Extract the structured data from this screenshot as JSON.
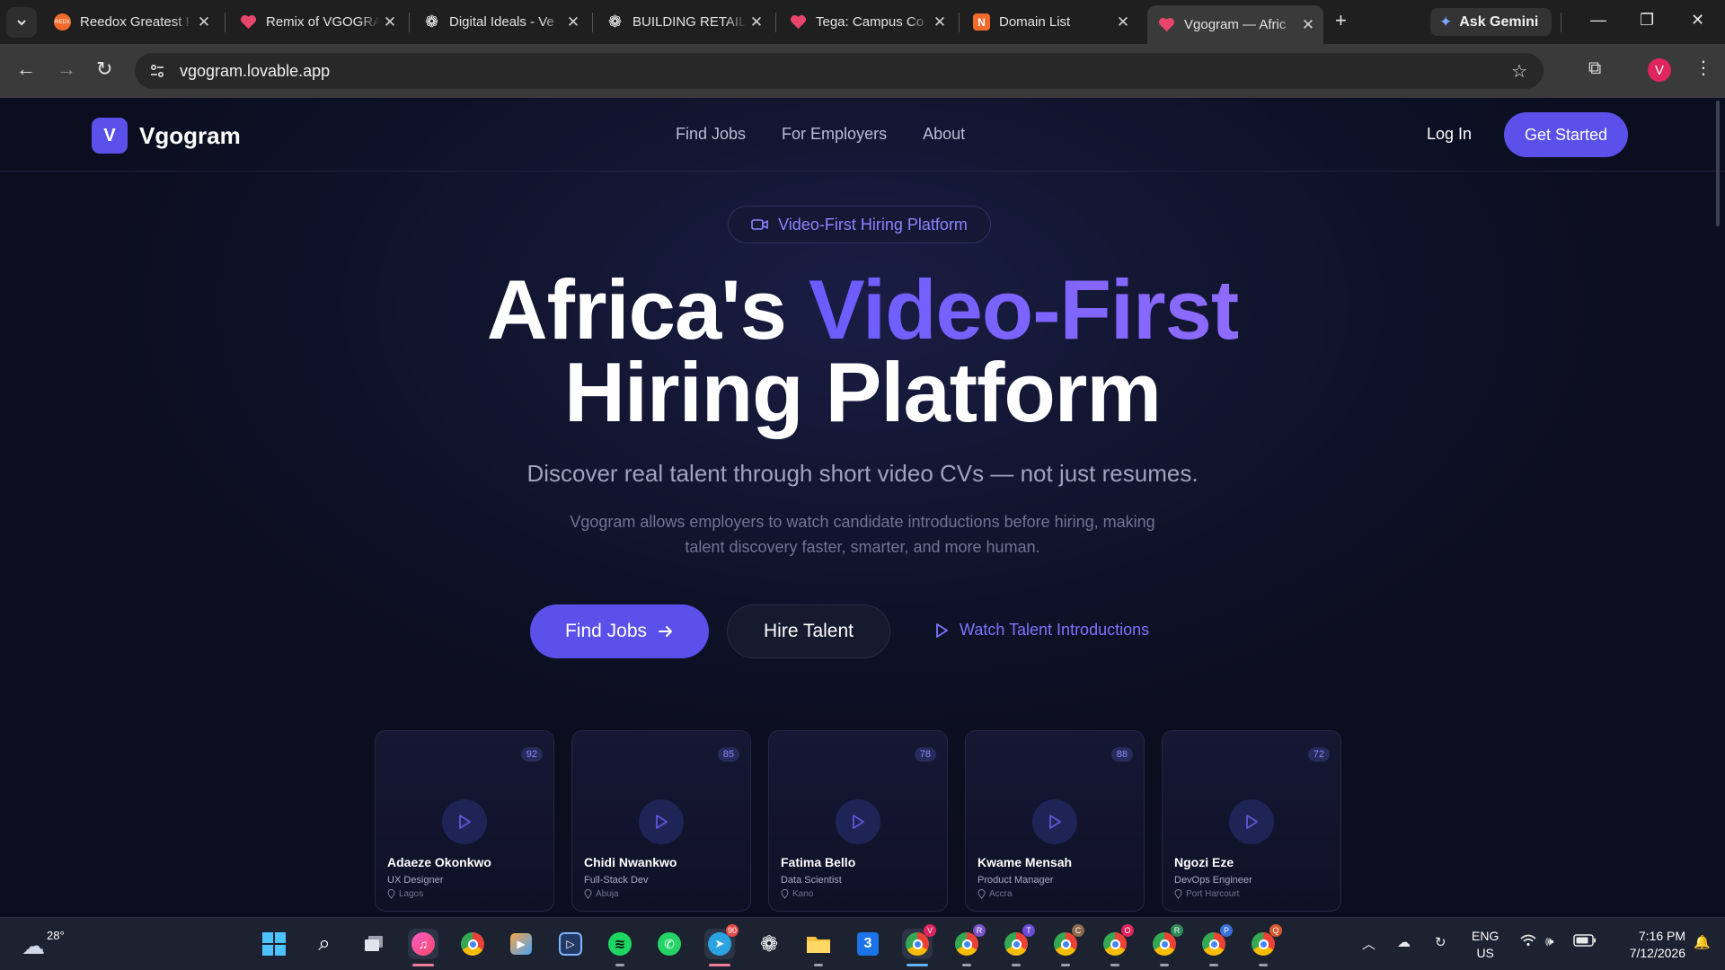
{
  "browser": {
    "tabs": [
      {
        "title": "Reedox Greatest !",
        "favicon_color": "#f26b2b",
        "favicon_text": "REDX"
      },
      {
        "title": "Remix of VGOGRAM",
        "favicon_color": "#e8456b",
        "favicon_text": ""
      },
      {
        "title": "Digital Ideals - Ve",
        "favicon_color": "#ffffff",
        "favicon_text": "❁"
      },
      {
        "title": "BUILDING RETAIL",
        "favicon_color": "#ffffff",
        "favicon_text": "❁"
      },
      {
        "title": "Tega: Campus Co",
        "favicon_color": "#e8456b",
        "favicon_text": ""
      },
      {
        "title": "Domain List",
        "favicon_color": "#f26b2b",
        "favicon_text": "N"
      },
      {
        "title": "Vgogram — Afric",
        "favicon_color": "#e8456b",
        "favicon_text": ""
      }
    ],
    "close_glyph": "✕",
    "new_tab": "+",
    "gemini_label": "Ask Gemini",
    "url": "vgogram.lovable.app",
    "profile_initial": "V"
  },
  "site": {
    "brand_logo": "V",
    "brand_name": "Vgogram",
    "nav": [
      "Find Jobs",
      "For Employers",
      "About"
    ],
    "login": "Log In",
    "get_started": "Get Started",
    "pill": "Video-First Hiring Platform",
    "title_line1_plain": "Africa's ",
    "title_line1_accent": "Video-First",
    "title_line2": "Hiring Platform",
    "subtitle": "Discover real talent through short video CVs — not just resumes.",
    "description": "Vgogram allows employers to watch candidate introductions before hiring, making talent discovery faster, smarter, and more human.",
    "cta_find": "Find Jobs",
    "cta_hire": "Hire Talent",
    "cta_watch": "Watch Talent Introductions",
    "accent_color": "#5b50ea",
    "candidates": [
      {
        "name": "Adaeze Okonkwo",
        "role": "UX Designer",
        "location": "Lagos",
        "score": "92"
      },
      {
        "name": "Chidi Nwankwo",
        "role": "Full-Stack Dev",
        "location": "Abuja",
        "score": "85"
      },
      {
        "name": "Fatima Bello",
        "role": "Data Scientist",
        "location": "Kano",
        "score": "78"
      },
      {
        "name": "Kwame Mensah",
        "role": "Product Manager",
        "location": "Accra",
        "score": "88"
      },
      {
        "name": "Ngozi Eze",
        "role": "DevOps Engineer",
        "location": "Port Harcourt",
        "score": "72"
      }
    ]
  },
  "taskbar": {
    "weather_temp": "28°",
    "badges": {
      "telegram": "90",
      "chrome_t": "T",
      "chrome_c": "C",
      "chrome_o": "O",
      "chrome_r": "R",
      "chrome_p": "P",
      "chrome_q": "Q",
      "chrome_r2": "R"
    },
    "lang_line1": "ENG",
    "lang_line2": "US",
    "time": "7:16 PM",
    "date": "7/12/2026"
  }
}
